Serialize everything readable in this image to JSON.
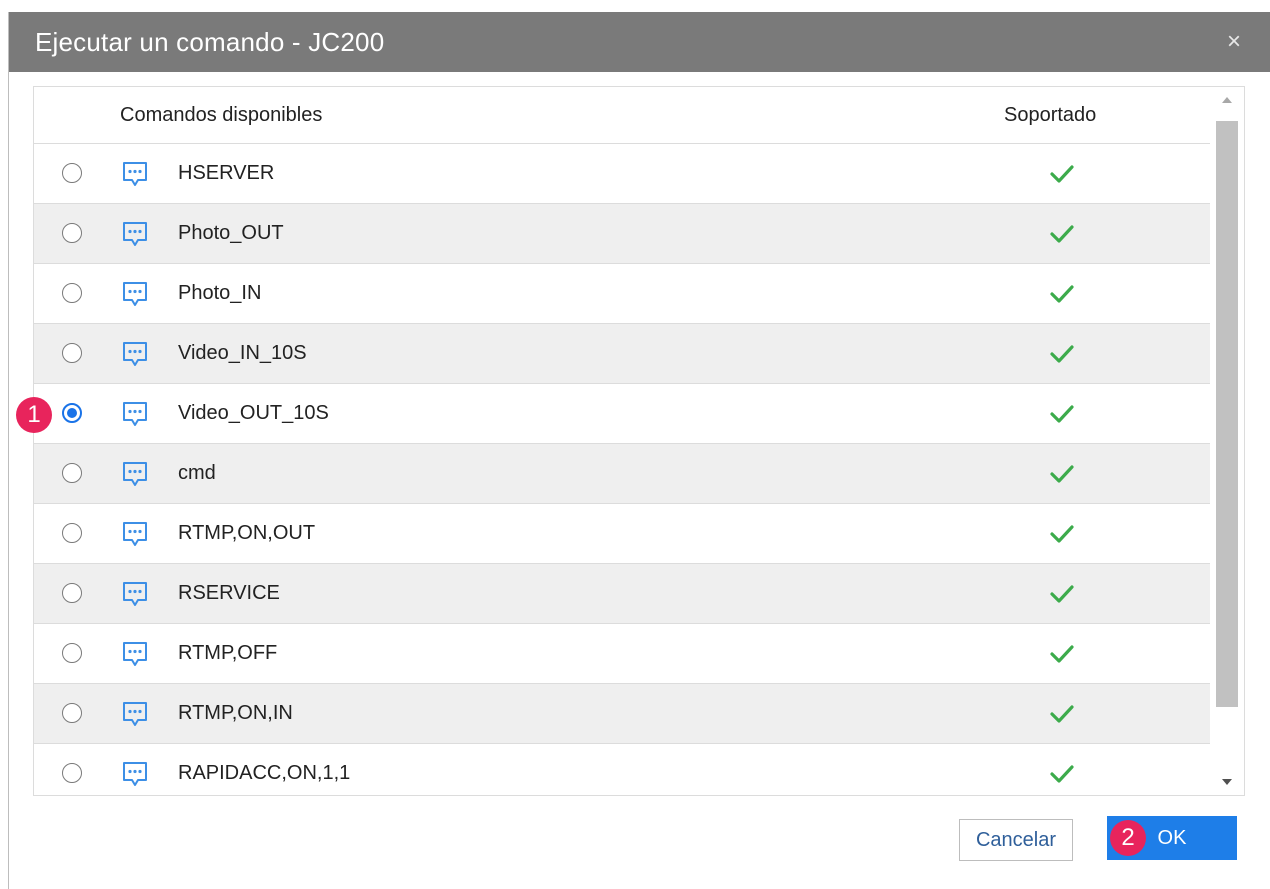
{
  "dialog": {
    "title": "Ejecutar un comando - JC200",
    "close_label": "×"
  },
  "table": {
    "headers": {
      "command": "Comandos disponibles",
      "supported": "Soportado"
    },
    "rows": [
      {
        "name": "HSERVER",
        "supported": true,
        "selected": false
      },
      {
        "name": "Photo_OUT",
        "supported": true,
        "selected": false
      },
      {
        "name": "Photo_IN",
        "supported": true,
        "selected": false
      },
      {
        "name": "Video_IN_10S",
        "supported": true,
        "selected": false
      },
      {
        "name": "Video_OUT_10S",
        "supported": true,
        "selected": true
      },
      {
        "name": "cmd",
        "supported": true,
        "selected": false
      },
      {
        "name": "RTMP,ON,OUT",
        "supported": true,
        "selected": false
      },
      {
        "name": "RSERVICE",
        "supported": true,
        "selected": false
      },
      {
        "name": "RTMP,OFF",
        "supported": true,
        "selected": false
      },
      {
        "name": "RTMP,ON,IN",
        "supported": true,
        "selected": false
      },
      {
        "name": "RAPIDACC,ON,1,1",
        "supported": true,
        "selected": false
      }
    ],
    "row_icon": "message-dots-icon",
    "supported_icon": "check-icon"
  },
  "buttons": {
    "cancel": "Cancelar",
    "ok": "OK"
  },
  "annotations": {
    "step1": "1",
    "step2": "2"
  },
  "colors": {
    "titlebar": "#7a7a7a",
    "accent": "#1e7ee8",
    "check": "#3cab4b",
    "badge": "#e8245c",
    "icon": "#3d8fe6"
  }
}
